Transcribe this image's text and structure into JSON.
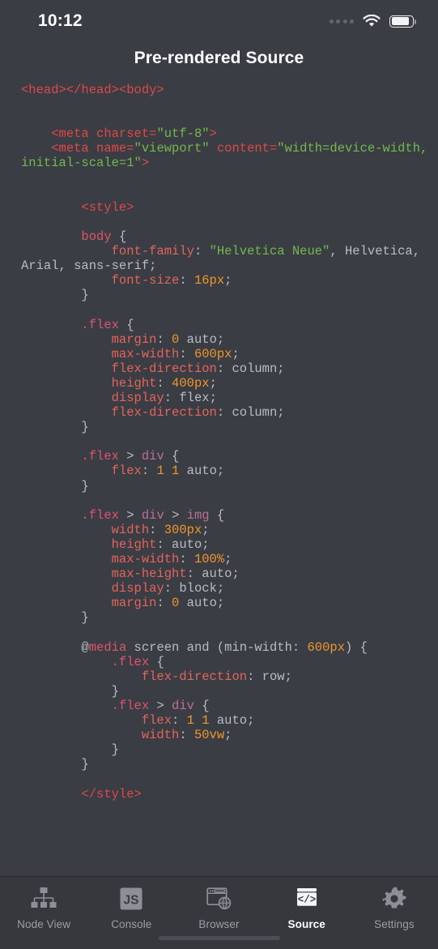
{
  "status_bar": {
    "time": "10:12",
    "signal_icon": "signal-dots-icon",
    "wifi_icon": "wifi-icon",
    "battery_icon": "battery-icon",
    "battery_level_pct": 88
  },
  "header": {
    "title": "Pre-rendered Source"
  },
  "source_view": {
    "language": "html",
    "lines": [
      {
        "indent": 0,
        "tokens": [
          {
            "t": "tag",
            "v": "<head></head><body>"
          }
        ]
      },
      {
        "indent": 0,
        "tokens": []
      },
      {
        "indent": 0,
        "tokens": []
      },
      {
        "indent": 0,
        "tokens": [
          {
            "t": "tag",
            "v": "    <meta "
          },
          {
            "t": "attr",
            "v": "charset="
          },
          {
            "t": "str",
            "v": "\"utf-8\""
          },
          {
            "t": "tag",
            "v": ">"
          }
        ]
      },
      {
        "indent": 0,
        "tokens": [
          {
            "t": "tag",
            "v": "    <meta "
          },
          {
            "t": "attr",
            "v": "name="
          },
          {
            "t": "str",
            "v": "\"viewport\""
          },
          {
            "t": "attr",
            "v": " content="
          },
          {
            "t": "str",
            "v": "\"width=device-width, initial-scale=1\""
          },
          {
            "t": "tag",
            "v": ">"
          }
        ]
      },
      {
        "indent": 0,
        "tokens": []
      },
      {
        "indent": 0,
        "tokens": []
      },
      {
        "indent": 0,
        "tokens": [
          {
            "t": "tag",
            "v": "        <style>"
          }
        ]
      },
      {
        "indent": 0,
        "tokens": []
      },
      {
        "indent": 0,
        "tokens": [
          {
            "t": "sel",
            "v": "        body "
          },
          {
            "t": "punc",
            "v": "{"
          }
        ]
      },
      {
        "indent": 0,
        "tokens": [
          {
            "t": "prop",
            "v": "            font-family"
          },
          {
            "t": "punc",
            "v": ": "
          },
          {
            "t": "str",
            "v": "\"Helvetica Neue\""
          },
          {
            "t": "val",
            "v": ", Helvetica, Arial, sans-serif;"
          }
        ]
      },
      {
        "indent": 0,
        "tokens": [
          {
            "t": "prop",
            "v": "            font-size"
          },
          {
            "t": "punc",
            "v": ": "
          },
          {
            "t": "num",
            "v": "16px"
          },
          {
            "t": "punc",
            "v": ";"
          }
        ]
      },
      {
        "indent": 0,
        "tokens": [
          {
            "t": "punc",
            "v": "        }"
          }
        ]
      },
      {
        "indent": 0,
        "tokens": []
      },
      {
        "indent": 0,
        "tokens": [
          {
            "t": "sel",
            "v": "        .flex "
          },
          {
            "t": "punc",
            "v": "{"
          }
        ]
      },
      {
        "indent": 0,
        "tokens": [
          {
            "t": "prop",
            "v": "            margin"
          },
          {
            "t": "punc",
            "v": ": "
          },
          {
            "t": "num",
            "v": "0"
          },
          {
            "t": "val",
            "v": " auto;"
          }
        ]
      },
      {
        "indent": 0,
        "tokens": [
          {
            "t": "prop",
            "v": "            max-width"
          },
          {
            "t": "punc",
            "v": ": "
          },
          {
            "t": "num",
            "v": "600px"
          },
          {
            "t": "punc",
            "v": ";"
          }
        ]
      },
      {
        "indent": 0,
        "tokens": [
          {
            "t": "prop",
            "v": "            flex-direction"
          },
          {
            "t": "punc",
            "v": ": "
          },
          {
            "t": "val",
            "v": "column;"
          }
        ]
      },
      {
        "indent": 0,
        "tokens": [
          {
            "t": "prop",
            "v": "            height"
          },
          {
            "t": "punc",
            "v": ": "
          },
          {
            "t": "num",
            "v": "400px"
          },
          {
            "t": "punc",
            "v": ";"
          }
        ]
      },
      {
        "indent": 0,
        "tokens": [
          {
            "t": "prop",
            "v": "            display"
          },
          {
            "t": "punc",
            "v": ": "
          },
          {
            "t": "val",
            "v": "flex;"
          }
        ]
      },
      {
        "indent": 0,
        "tokens": [
          {
            "t": "prop",
            "v": "            flex-direction"
          },
          {
            "t": "punc",
            "v": ": "
          },
          {
            "t": "val",
            "v": "column;"
          }
        ]
      },
      {
        "indent": 0,
        "tokens": [
          {
            "t": "punc",
            "v": "        }"
          }
        ]
      },
      {
        "indent": 0,
        "tokens": []
      },
      {
        "indent": 0,
        "tokens": [
          {
            "t": "sel",
            "v": "        .flex "
          },
          {
            "t": "val",
            "v": "> "
          },
          {
            "t": "el",
            "v": "div "
          },
          {
            "t": "punc",
            "v": "{"
          }
        ]
      },
      {
        "indent": 0,
        "tokens": [
          {
            "t": "prop",
            "v": "            flex"
          },
          {
            "t": "punc",
            "v": ": "
          },
          {
            "t": "num",
            "v": "1 1"
          },
          {
            "t": "val",
            "v": " auto;"
          }
        ]
      },
      {
        "indent": 0,
        "tokens": [
          {
            "t": "punc",
            "v": "        }"
          }
        ]
      },
      {
        "indent": 0,
        "tokens": []
      },
      {
        "indent": 0,
        "tokens": [
          {
            "t": "sel",
            "v": "        .flex "
          },
          {
            "t": "val",
            "v": "> "
          },
          {
            "t": "el",
            "v": "div "
          },
          {
            "t": "val",
            "v": "> "
          },
          {
            "t": "el",
            "v": "img "
          },
          {
            "t": "punc",
            "v": "{"
          }
        ]
      },
      {
        "indent": 0,
        "tokens": [
          {
            "t": "prop",
            "v": "            width"
          },
          {
            "t": "punc",
            "v": ": "
          },
          {
            "t": "num",
            "v": "300px"
          },
          {
            "t": "punc",
            "v": ";"
          }
        ]
      },
      {
        "indent": 0,
        "tokens": [
          {
            "t": "prop",
            "v": "            height"
          },
          {
            "t": "punc",
            "v": ": "
          },
          {
            "t": "val",
            "v": "auto;"
          }
        ]
      },
      {
        "indent": 0,
        "tokens": [
          {
            "t": "prop",
            "v": "            max-width"
          },
          {
            "t": "punc",
            "v": ": "
          },
          {
            "t": "num",
            "v": "100%"
          },
          {
            "t": "punc",
            "v": ";"
          }
        ]
      },
      {
        "indent": 0,
        "tokens": [
          {
            "t": "prop",
            "v": "            max-height"
          },
          {
            "t": "punc",
            "v": ": "
          },
          {
            "t": "val",
            "v": "auto;"
          }
        ]
      },
      {
        "indent": 0,
        "tokens": [
          {
            "t": "prop",
            "v": "            display"
          },
          {
            "t": "punc",
            "v": ": "
          },
          {
            "t": "val",
            "v": "block;"
          }
        ]
      },
      {
        "indent": 0,
        "tokens": [
          {
            "t": "prop",
            "v": "            margin"
          },
          {
            "t": "punc",
            "v": ": "
          },
          {
            "t": "num",
            "v": "0"
          },
          {
            "t": "val",
            "v": " auto;"
          }
        ]
      },
      {
        "indent": 0,
        "tokens": [
          {
            "t": "punc",
            "v": "        }"
          }
        ]
      },
      {
        "indent": 0,
        "tokens": []
      },
      {
        "indent": 0,
        "tokens": [
          {
            "t": "val",
            "v": "        @"
          },
          {
            "t": "at",
            "v": "media"
          },
          {
            "t": "val",
            "v": " screen and (min-width: "
          },
          {
            "t": "num",
            "v": "600px"
          },
          {
            "t": "val",
            "v": ") {"
          }
        ]
      },
      {
        "indent": 0,
        "tokens": [
          {
            "t": "sel",
            "v": "            .flex "
          },
          {
            "t": "punc",
            "v": "{"
          }
        ]
      },
      {
        "indent": 0,
        "tokens": [
          {
            "t": "prop",
            "v": "                flex-direction"
          },
          {
            "t": "punc",
            "v": ": "
          },
          {
            "t": "val",
            "v": "row;"
          }
        ]
      },
      {
        "indent": 0,
        "tokens": [
          {
            "t": "punc",
            "v": "            }"
          }
        ]
      },
      {
        "indent": 0,
        "tokens": [
          {
            "t": "sel",
            "v": "            .flex "
          },
          {
            "t": "val",
            "v": "> "
          },
          {
            "t": "el",
            "v": "div "
          },
          {
            "t": "punc",
            "v": "{"
          }
        ]
      },
      {
        "indent": 0,
        "tokens": [
          {
            "t": "prop",
            "v": "                flex"
          },
          {
            "t": "punc",
            "v": ": "
          },
          {
            "t": "num",
            "v": "1 1"
          },
          {
            "t": "val",
            "v": " auto;"
          }
        ]
      },
      {
        "indent": 0,
        "tokens": [
          {
            "t": "prop",
            "v": "                width"
          },
          {
            "t": "punc",
            "v": ": "
          },
          {
            "t": "num",
            "v": "50vw"
          },
          {
            "t": "punc",
            "v": ";"
          }
        ]
      },
      {
        "indent": 0,
        "tokens": [
          {
            "t": "punc",
            "v": "            }"
          }
        ]
      },
      {
        "indent": 0,
        "tokens": [
          {
            "t": "punc",
            "v": "        }"
          }
        ]
      },
      {
        "indent": 0,
        "tokens": []
      },
      {
        "indent": 0,
        "tokens": [
          {
            "t": "tag",
            "v": "        </style>"
          }
        ]
      }
    ]
  },
  "tab_bar": {
    "active_tab": "Source",
    "tabs": [
      {
        "label": "Node View",
        "icon": "node-tree-icon"
      },
      {
        "label": "Console",
        "icon": "js-square-icon"
      },
      {
        "label": "Browser",
        "icon": "browser-globe-icon"
      },
      {
        "label": "Source",
        "icon": "code-brackets-icon"
      },
      {
        "label": "Settings",
        "icon": "gear-icon"
      }
    ]
  },
  "colors": {
    "background": "#3a3d44",
    "tabbar_background": "#36383e",
    "tag": "#e04848",
    "string": "#73b84f",
    "selector": "#e0536b",
    "property": "#e4645c",
    "number": "#f0962c",
    "text": "#b9bcc2",
    "active_tab": "#ffffff",
    "inactive_tab": "#9b9ea4"
  }
}
